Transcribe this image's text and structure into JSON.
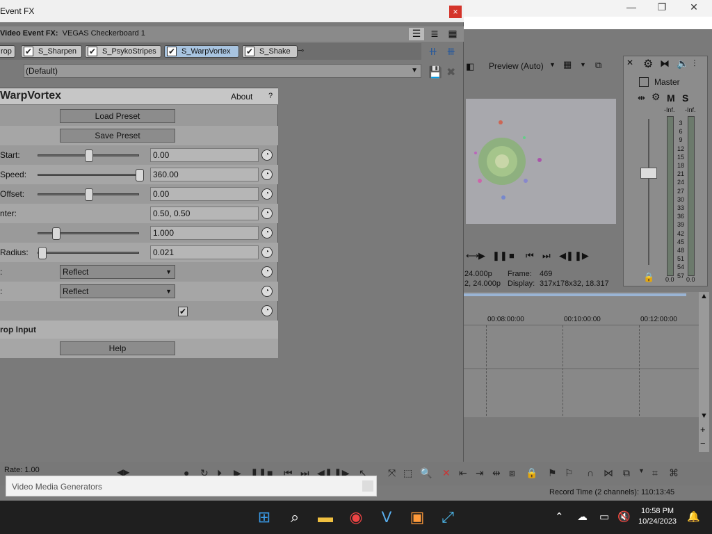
{
  "fx_window": {
    "title": "Event FX",
    "close_glyph": "×",
    "header_prefix": "Video Event FX:",
    "header_media": "VEGAS Checkerboard 1",
    "chain": [
      {
        "label": "rop",
        "checked": false,
        "active": false
      },
      {
        "label": "S_Sharpen",
        "checked": true,
        "active": false
      },
      {
        "label": "S_PsykoStripes",
        "checked": true,
        "active": false
      },
      {
        "label": "S_WarpVortex",
        "checked": true,
        "active": true
      },
      {
        "label": "S_Shake",
        "checked": true,
        "active": false
      }
    ],
    "preset": "(Default)"
  },
  "warpvortex": {
    "title": "WarpVortex",
    "about": "About",
    "help_q": "?",
    "load_preset": "Load Preset",
    "save_preset": "Save Preset",
    "params": [
      {
        "label": "Start:",
        "value": "0.00",
        "slider": 0.5
      },
      {
        "label": "Speed:",
        "value": "360.00",
        "slider": 1.0
      },
      {
        "label": "Offset:",
        "value": "0.00",
        "slider": 0.5
      },
      {
        "label": "nter:",
        "value": "0.50, 0.50",
        "slider": null
      },
      {
        "label": "",
        "value": "1.000",
        "slider": 0.18
      },
      {
        "label": "Radius:",
        "value": "0.021",
        "slider": 0.04
      }
    ],
    "combo_x_label": ":",
    "combo_x_value": "Reflect",
    "combo_y_label": ":",
    "combo_y_value": "Reflect",
    "checkbox_checked": true,
    "section_crop": "rop Input",
    "help": "Help"
  },
  "preview": {
    "quality": "Preview (Auto)",
    "info_row1_c1": "24.000p",
    "info_row1_c2": "Frame:",
    "info_row1_c3": "469",
    "info_row2_c1": "2, 24.000p",
    "info_row2_c2": "Display:",
    "info_row2_c3": "317x178x32, 18.317"
  },
  "master": {
    "title": "Master",
    "m": "M",
    "s": "S",
    "inf_left": "-Inf.",
    "inf_right": "-Inf.",
    "scale": [
      "3",
      "6",
      "9",
      "12",
      "15",
      "18",
      "21",
      "24",
      "27",
      "30",
      "33",
      "36",
      "39",
      "42",
      "45",
      "48",
      "51",
      "54",
      "57"
    ],
    "zero_left": "0.0",
    "zero_right": "0.0"
  },
  "timeline": {
    "ruler": [
      "00:08:00:00",
      "00:10:00:00",
      "00:12:00:00"
    ]
  },
  "bottom": {
    "rate": "Rate: 1.00",
    "record_time": "Record Time (2 channels): 110:13:45",
    "video_media_generators": "Video Media Generators"
  },
  "taskbar": {
    "time": "10:58 PM",
    "date": "10/24/2023"
  }
}
